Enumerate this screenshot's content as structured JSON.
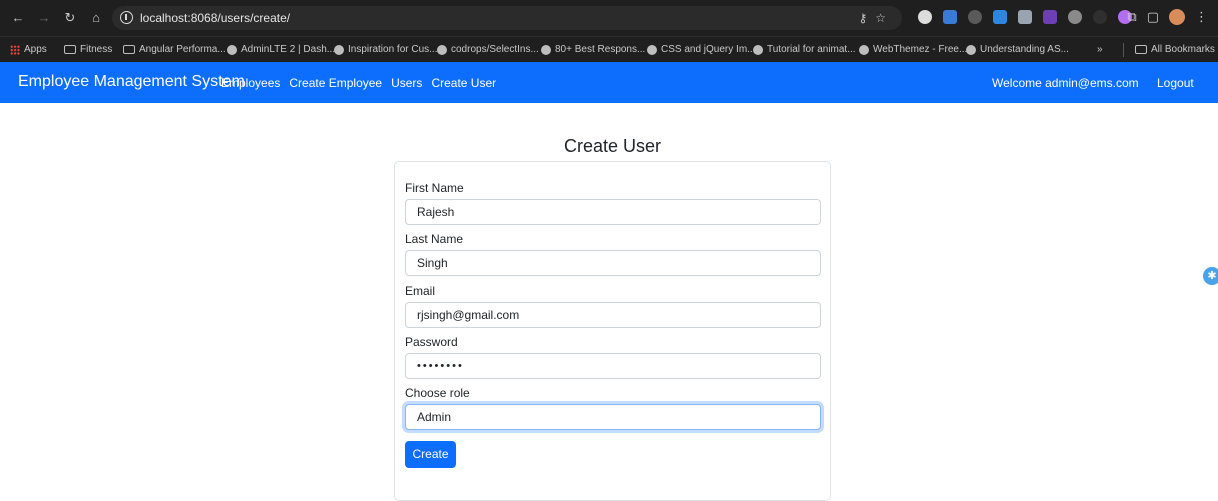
{
  "browser": {
    "url": "localhost:8068/users/create/",
    "bookmarks": [
      {
        "label": "Apps",
        "icon": "apps-grid-icon"
      },
      {
        "label": "Fitness",
        "icon": "folder-icon"
      },
      {
        "label": "Angular Performa...",
        "icon": "folder-icon"
      },
      {
        "label": "AdminLTE 2 | Dash...",
        "icon": "globe-icon"
      },
      {
        "label": "Inspiration for Cus...",
        "icon": "globe-icon"
      },
      {
        "label": "codrops/SelectIns...",
        "icon": "globe-icon"
      },
      {
        "label": "80+ Best Respons...",
        "icon": "globe-icon"
      },
      {
        "label": "CSS and jQuery Im...",
        "icon": "globe-icon"
      },
      {
        "label": "Tutorial for animat...",
        "icon": "globe-icon"
      },
      {
        "label": "WebThemez - Free...",
        "icon": "globe-icon"
      },
      {
        "label": "Understanding AS...",
        "icon": "globe-icon"
      }
    ],
    "overflow_label": "»",
    "all_bookmarks": "All Bookmarks"
  },
  "navbar": {
    "brand": "Employee Management System",
    "links": [
      "Employees",
      "Create Employee",
      "Users",
      "Create User"
    ],
    "welcome": "Welcome admin@ems.com",
    "logout": "Logout",
    "color": "#0d6efd"
  },
  "form": {
    "title": "Create User",
    "fields": [
      {
        "label": "First Name",
        "value": "Rajesh"
      },
      {
        "label": "Last Name",
        "value": "Singh"
      },
      {
        "label": "Email",
        "value": "rjsingh@gmail.com"
      },
      {
        "label": "Password",
        "value": "••••••••"
      },
      {
        "label": "Choose role",
        "value": "Admin"
      }
    ],
    "submit": "Create"
  }
}
